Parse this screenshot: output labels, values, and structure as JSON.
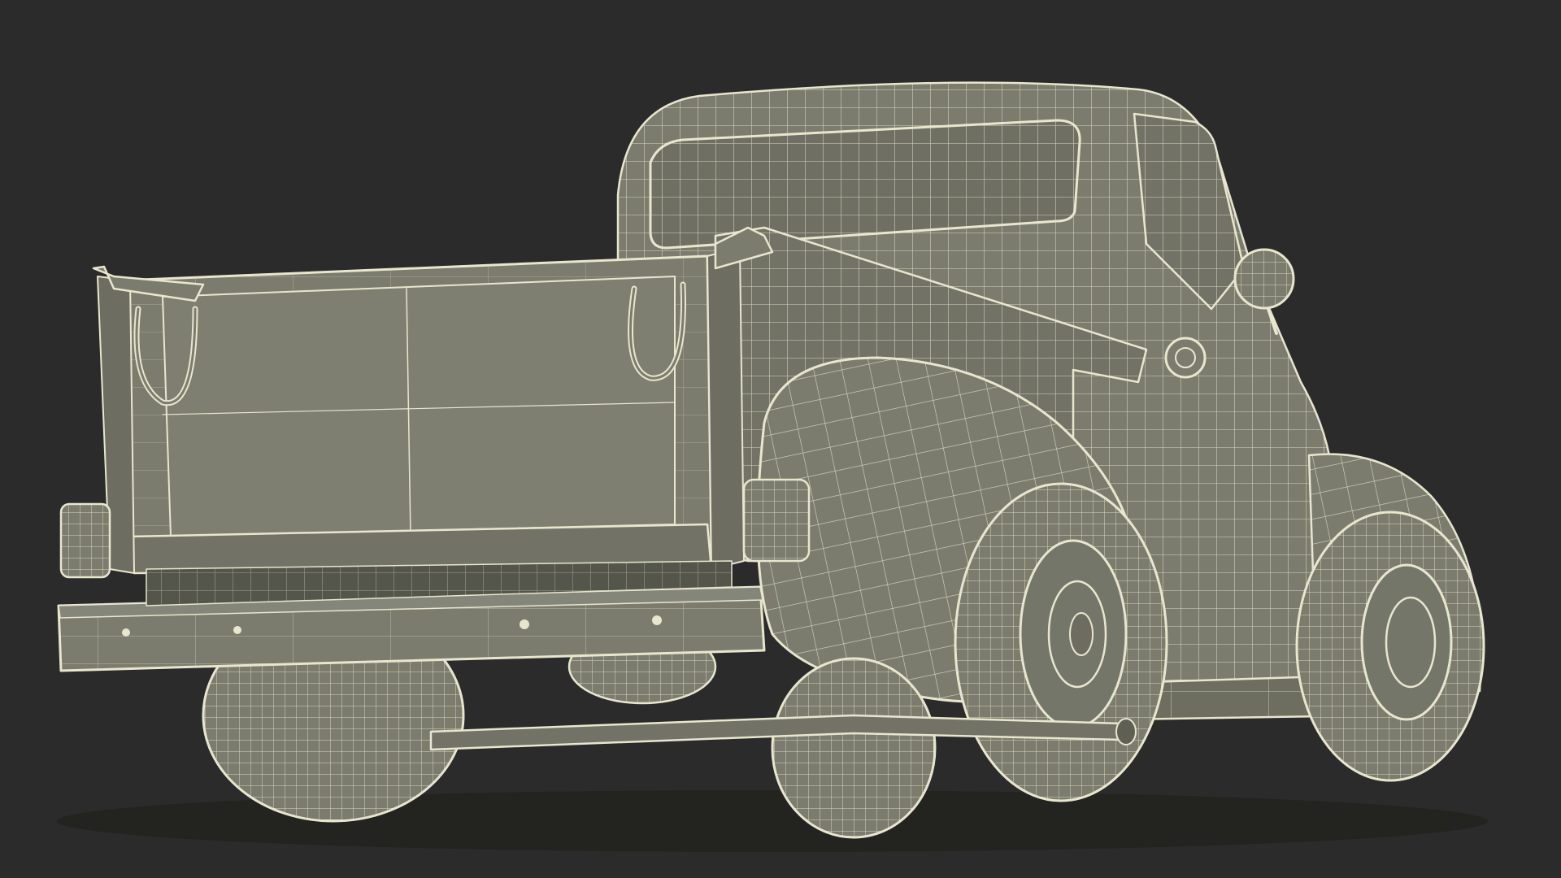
{
  "scene": {
    "subject": "truck-wireframe-model",
    "colors": {
      "background": "#2b2b2b",
      "surface": "#7b7c6d",
      "surface_dark": "#66675a",
      "surface_light": "#8a8b7c",
      "wire": "#e8e6cf",
      "shadow": "#3a3a33"
    }
  }
}
